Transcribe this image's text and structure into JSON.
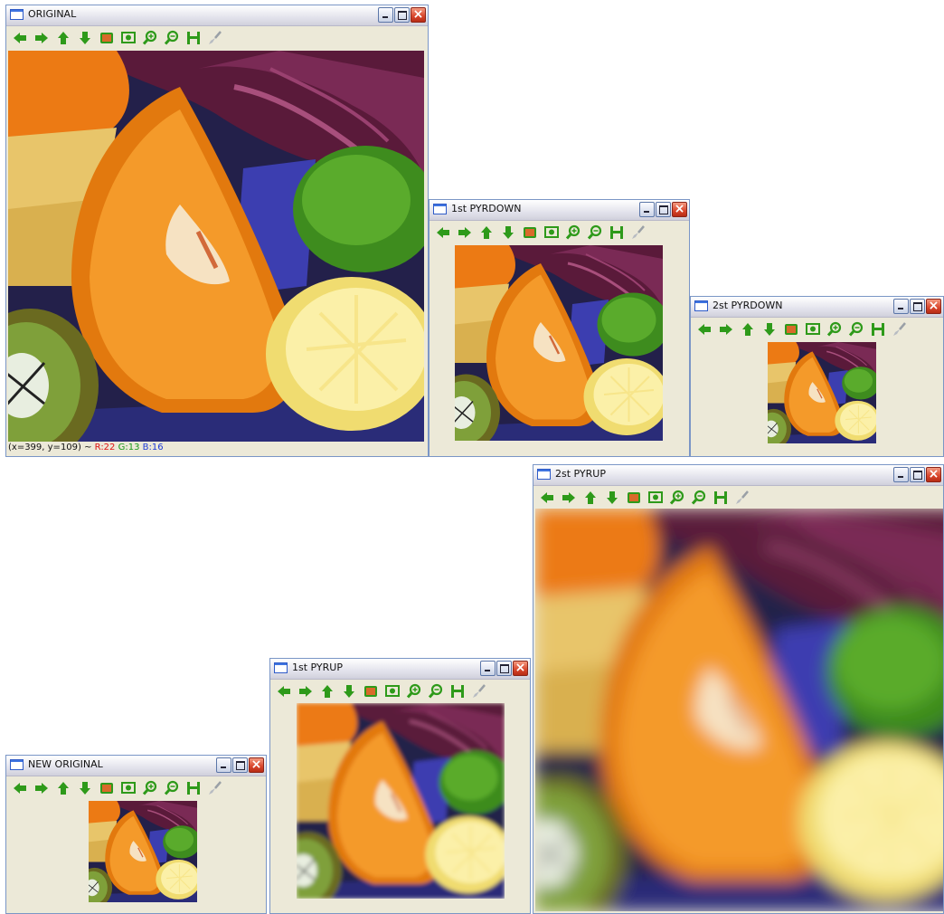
{
  "windows": {
    "original": {
      "title": "ORIGINAL"
    },
    "pyrdown1": {
      "title": "1st PYRDOWN"
    },
    "pyrdown2": {
      "title": "2st PYRDOWN"
    },
    "pyrup2": {
      "title": "2st PYRUP"
    },
    "pyrup1": {
      "title": "1st PYRUP"
    },
    "new_original": {
      "title": "NEW ORIGINAL"
    }
  },
  "status": {
    "coords": "(x=399, y=109) ~ ",
    "r": "R:22",
    "g": "G:13",
    "b": "B:16"
  },
  "toolbar_icons": [
    "arrow-left-icon",
    "arrow-right-icon",
    "arrow-up-icon",
    "arrow-down-icon",
    "fit-image-icon",
    "zoom-region-icon",
    "zoom-in-icon",
    "zoom-out-icon",
    "save-icon",
    "properties-brush-icon"
  ],
  "colors": {
    "icon_green": "#2e9a1a",
    "title_border": "#7a96c6",
    "window_bg": "#ece9d8",
    "close_red": "#d8452b"
  }
}
